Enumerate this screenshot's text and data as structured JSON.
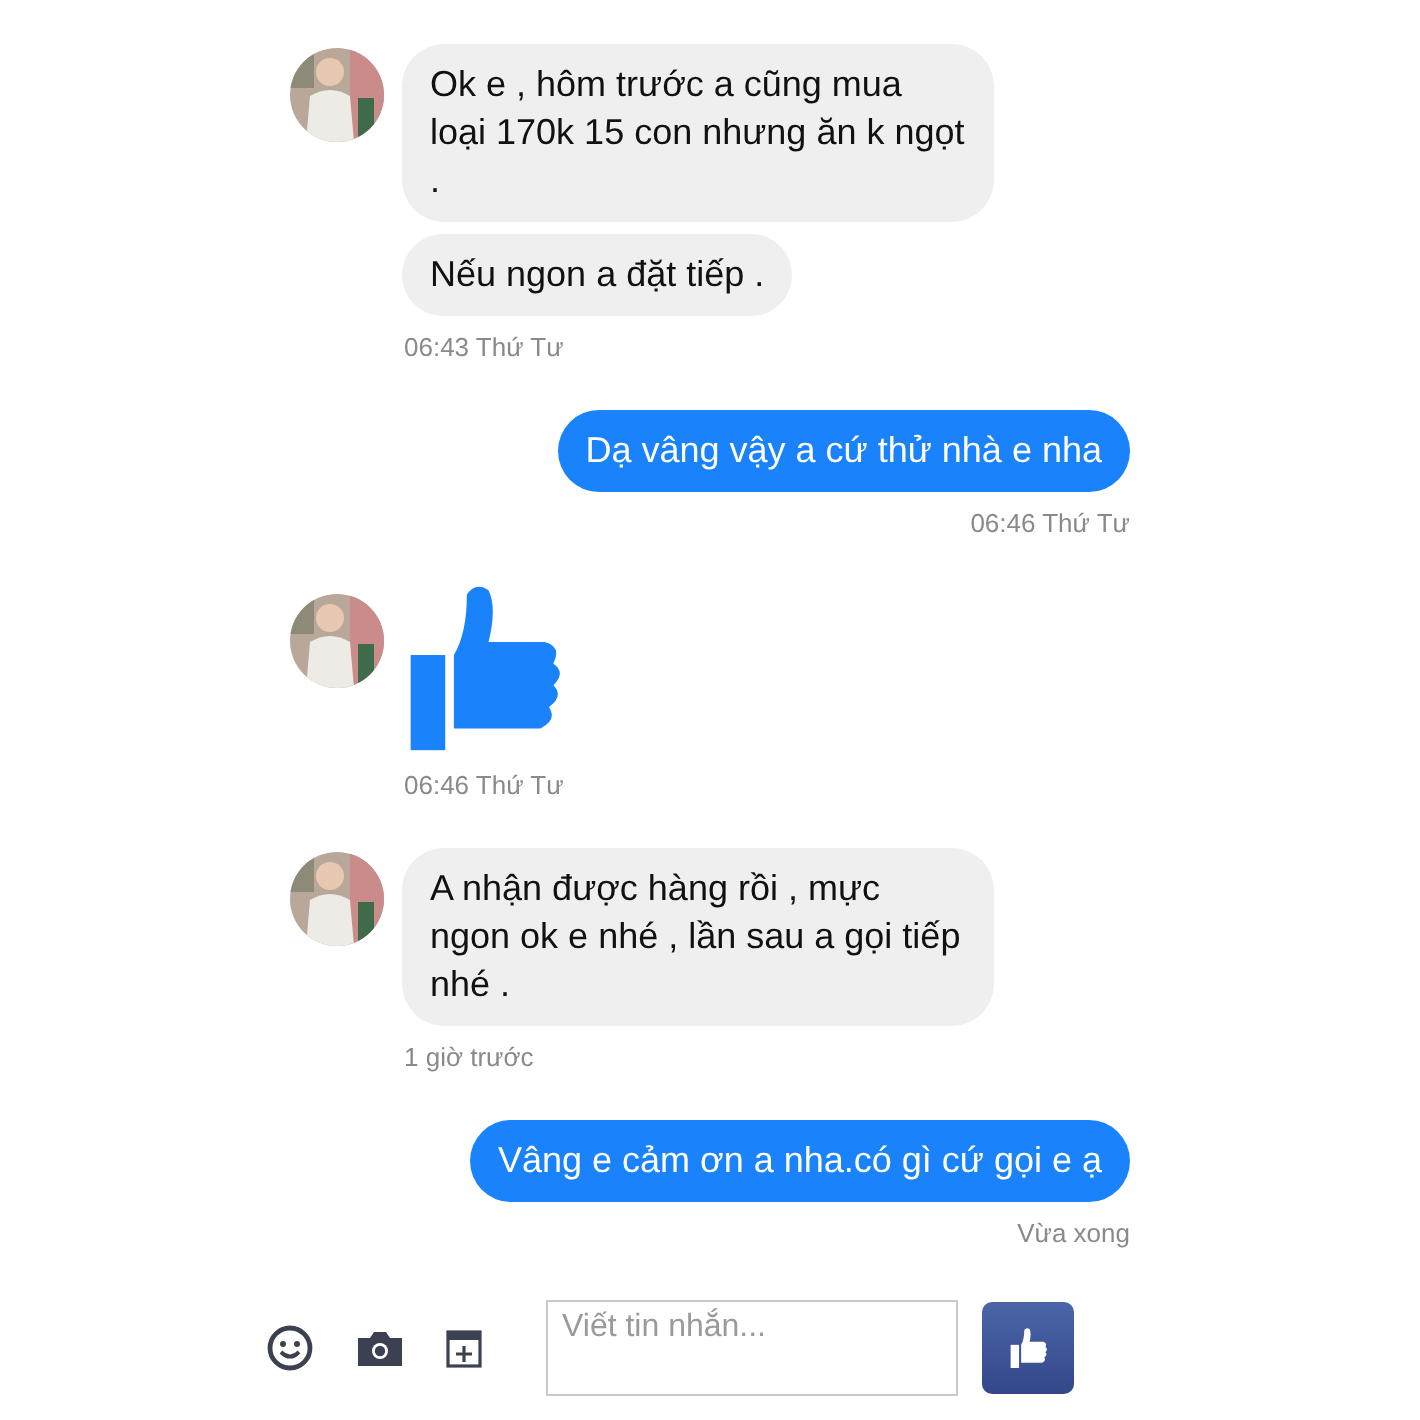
{
  "messages": [
    {
      "kind": "incoming",
      "items": [
        {
          "kind": "text",
          "text": "Ok e , hôm trước a cũng mua loại 170k 15 con nhưng ăn k ngọt ."
        },
        {
          "kind": "text",
          "text": "Nếu ngon a đặt tiếp ."
        }
      ],
      "time": "06:43 Thứ Tư"
    },
    {
      "kind": "outgoing",
      "items": [
        {
          "kind": "text",
          "text": "Dạ vâng vậy a cứ thử nhà e nha"
        }
      ],
      "time": "06:46 Thứ Tư"
    },
    {
      "kind": "incoming",
      "items": [
        {
          "kind": "like"
        }
      ],
      "time": "06:46 Thứ Tư"
    },
    {
      "kind": "incoming",
      "items": [
        {
          "kind": "text",
          "text": "A nhận được hàng rồi , mực ngon ok e nhé , lần sau a gọi tiếp nhé ."
        }
      ],
      "time": "1 giờ trước"
    },
    {
      "kind": "outgoing",
      "items": [
        {
          "kind": "text",
          "text": "Vâng e cảm ơn a nha.có gì cứ gọi e ạ"
        }
      ],
      "time": "Vừa xong"
    }
  ],
  "composer": {
    "placeholder": "Viết tin nhắn..."
  }
}
